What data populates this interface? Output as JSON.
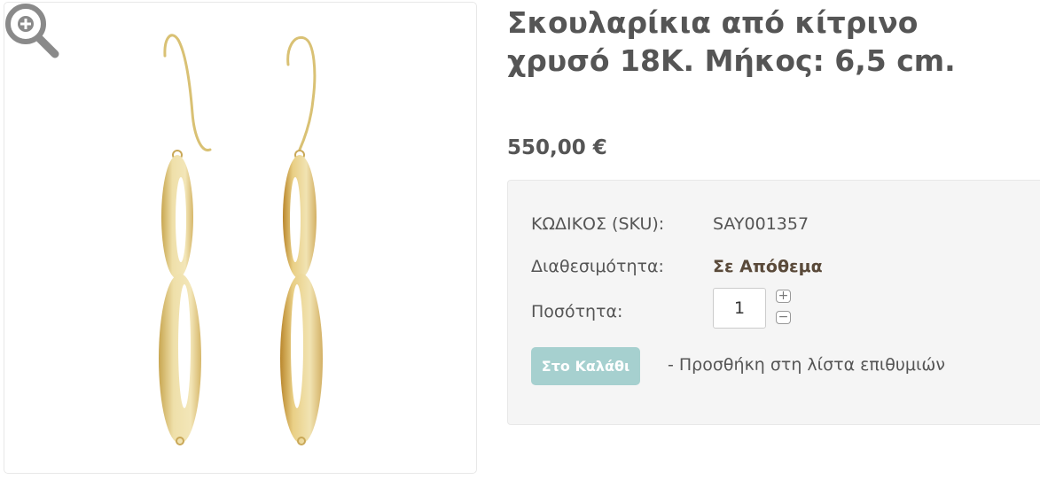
{
  "product": {
    "title": "Σκουλαρίκια από κίτρινο χρυσό 18K. Μήκος: 6,5 cm.",
    "price": "550,00 €"
  },
  "details": {
    "sku_label": "ΚΩΔΙΚΟΣ (SKU):",
    "sku_value": "SAY001357",
    "availability_label": "Διαθεσιμότητα:",
    "availability_value": "Σε Απόθεμα",
    "quantity_label": "Ποσότητα:",
    "quantity_value": "1",
    "increment_symbol": "+",
    "decrement_symbol": "−"
  },
  "actions": {
    "add_to_cart": "Στο Καλάθι",
    "add_to_wishlist": "- Προσθήκη στη λίστα επιθυμιών"
  },
  "colors": {
    "cart_button": "#a6d0cf",
    "stock_text": "#5a4a3a",
    "gold": "#e6d39a"
  },
  "icons": {
    "zoom": "zoom-in-icon"
  }
}
